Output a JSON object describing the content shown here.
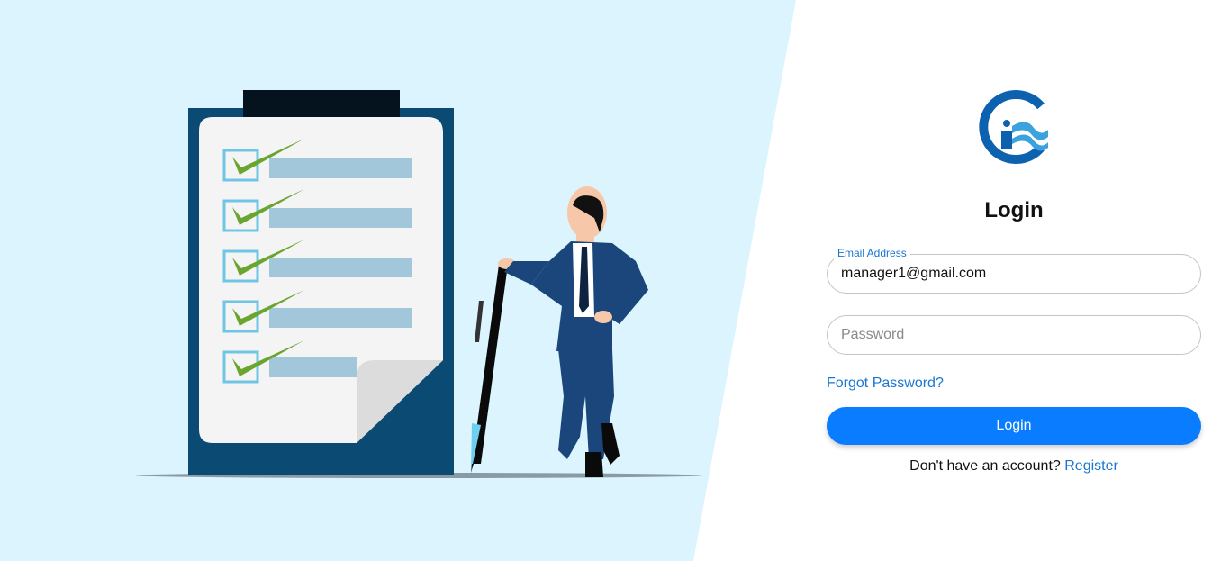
{
  "colors": {
    "left_panel_bg": "#dbf4fd",
    "accent": "#0a7cff",
    "link": "#1976d2",
    "logo_blue": "#0d62b0"
  },
  "logo": {
    "icon": "brand-logo-icon"
  },
  "illustration": {
    "icon": "checklist-businessman-illustration"
  },
  "login": {
    "title": "Login",
    "email": {
      "label": "Email Address",
      "value": "manager1@gmail.com"
    },
    "password": {
      "placeholder": "Password",
      "value": ""
    },
    "forgot_password": "Forgot Password?",
    "submit_label": "Login",
    "register_prompt": "Don't have an account? ",
    "register_link": "Register"
  }
}
